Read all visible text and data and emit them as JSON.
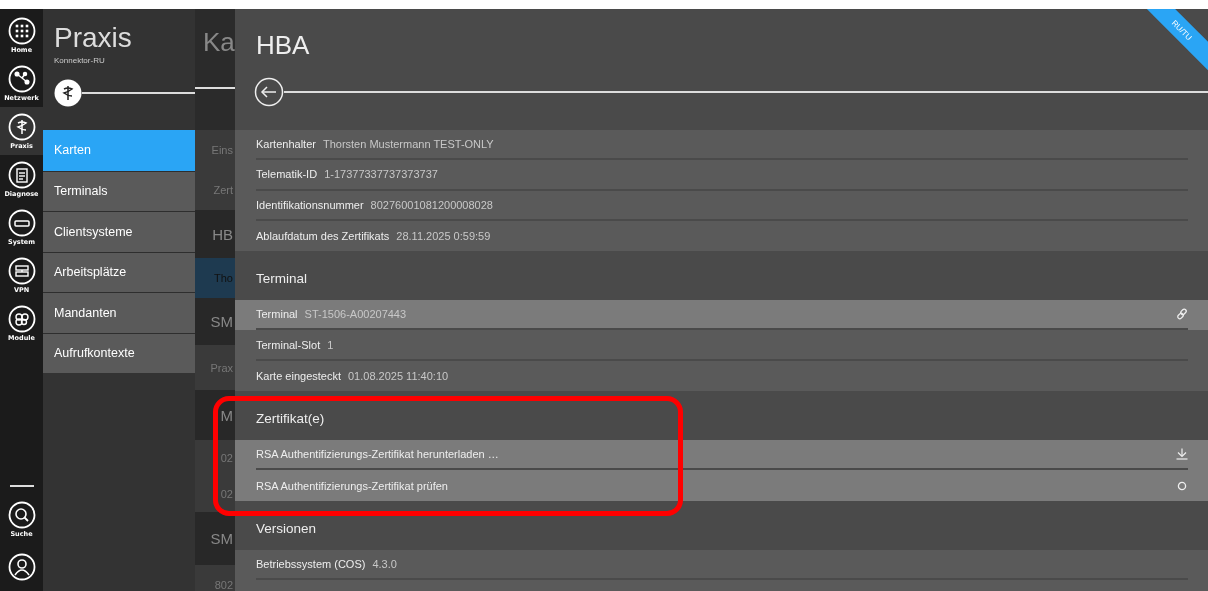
{
  "rail": {
    "items": [
      {
        "label": "Home",
        "selected": false
      },
      {
        "label": "Netzwerk",
        "selected": false
      },
      {
        "label": "Praxis",
        "selected": true
      },
      {
        "label": "Diagnose",
        "selected": false
      },
      {
        "label": "System",
        "selected": false
      },
      {
        "label": "VPN",
        "selected": false
      },
      {
        "label": "Module",
        "selected": false
      }
    ],
    "bottom": [
      {
        "kind": "search",
        "label": "Suche"
      },
      {
        "kind": "user"
      }
    ]
  },
  "app": {
    "title": "Praxis",
    "subtitle": "Konnektor-RU"
  },
  "nav": [
    {
      "label": "Karten",
      "selected": true
    },
    {
      "label": "Terminals",
      "selected": false
    },
    {
      "label": "Clientsysteme",
      "selected": false
    },
    {
      "label": "Arbeitsplätze",
      "selected": false
    },
    {
      "label": "Mandanten",
      "selected": false
    },
    {
      "label": "Aufrufkontexte",
      "selected": false
    }
  ],
  "list": {
    "heading": "Ka",
    "rows": [
      {
        "kind": "row",
        "text": "Eins",
        "selected": false
      },
      {
        "kind": "row",
        "text": "Zert",
        "selected": false
      },
      {
        "kind": "section",
        "text": "HB",
        "selected": false
      },
      {
        "kind": "row",
        "text": "Tho",
        "selected": true
      },
      {
        "kind": "section",
        "text": "SM",
        "selected": false
      },
      {
        "kind": "row",
        "text": "Prax",
        "selected": false
      },
      {
        "kind": "section",
        "text": "M",
        "selected": false
      },
      {
        "kind": "row",
        "text": "02",
        "selected": false
      },
      {
        "kind": "row",
        "text": "02",
        "selected": false
      },
      {
        "kind": "section",
        "text": "SM",
        "selected": false
      },
      {
        "kind": "row",
        "text": "802",
        "selected": false
      }
    ]
  },
  "detail": {
    "title": "HBA",
    "badge": "RU/TU",
    "sections": [
      {
        "rows": [
          {
            "kind": "field",
            "label": "Kartenhalter",
            "value": "Thorsten Mustermann TEST-ONLY"
          },
          {
            "kind": "field",
            "label": "Telematik-ID",
            "value": "1-17377337737373737"
          },
          {
            "kind": "field",
            "label": "Identifikationsnummer",
            "value": "80276001081200008028"
          },
          {
            "kind": "field",
            "label": "Ablaufdatum des Zertifikats",
            "value": "28.11.2025 0:59:59"
          }
        ]
      },
      {
        "heading": "Terminal",
        "rows": [
          {
            "kind": "link",
            "label": "Terminal",
            "value": "ST-1506-A00207443"
          },
          {
            "kind": "field",
            "label": "Terminal-Slot",
            "value": "1"
          },
          {
            "kind": "field",
            "label": "Karte eingesteckt",
            "value": "01.08.2025 11:40:10"
          }
        ]
      },
      {
        "heading": "Zertifikat(e)",
        "rows": [
          {
            "kind": "download",
            "label": "RSA Authentifizierungs-Zertifikat herunterladen …"
          },
          {
            "kind": "check",
            "label": "RSA Authentifizierungs-Zertifikat prüfen"
          }
        ]
      },
      {
        "heading": "Versionen",
        "rows": [
          {
            "kind": "field",
            "label": "Betriebssystem (COS)",
            "value": "4.3.0"
          },
          {
            "kind": "blank"
          }
        ]
      }
    ]
  },
  "annotation": {
    "kind": "highlight"
  }
}
